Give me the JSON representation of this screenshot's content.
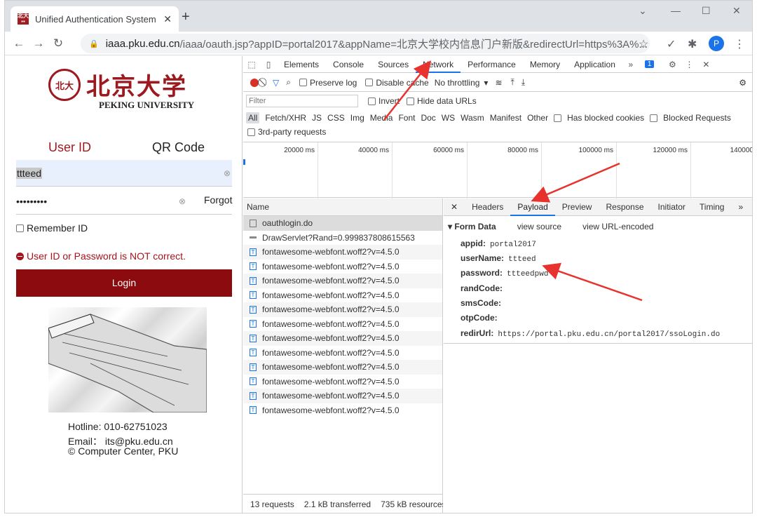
{
  "browser": {
    "tab_title": "Unified Authentication System",
    "url_host": "iaaa.pku.edu.cn",
    "url_path": "/iaaa/oauth.jsp?appID=portal2017&appName=北京大学校内信息门户新版&redirectUrl=https%3A%...",
    "profile_initial": "P"
  },
  "login": {
    "logo_cn": "北京大学",
    "logo_en": "PEKING UNIVERSITY",
    "tab_user": "User ID",
    "tab_qr": "QR Code",
    "username_value": "ttteed",
    "password_mask": "•••••••••",
    "forgot": "Forgot",
    "remember": "Remember ID",
    "error": "User ID or Password is NOT correct.",
    "login_button": "Login",
    "hotline": "Hotline: 010-62751023",
    "email": "Email： its@pku.edu.cn",
    "copyright": "© Computer Center, PKU"
  },
  "devtools": {
    "tabs": [
      "Elements",
      "Console",
      "Sources",
      "Network",
      "Performance",
      "Memory",
      "Application"
    ],
    "active_tab": "Network",
    "issues_count": "1",
    "preserve_log": "Preserve log",
    "disable_cache": "Disable cache",
    "throttling": "No throttling",
    "filter_placeholder": "Filter",
    "invert": "Invert",
    "hide_data_urls": "Hide data URLs",
    "types": [
      "All",
      "Fetch/XHR",
      "JS",
      "CSS",
      "Img",
      "Media",
      "Font",
      "Doc",
      "WS",
      "Wasm",
      "Manifest",
      "Other"
    ],
    "has_blocked_cookies": "Has blocked cookies",
    "blocked_requests": "Blocked Requests",
    "third_party": "3rd-party requests",
    "timeline_ticks": [
      "20000 ms",
      "40000 ms",
      "60000 ms",
      "80000 ms",
      "100000 ms",
      "120000 ms",
      "140000"
    ],
    "name_header": "Name",
    "requests": [
      "oauthlogin.do",
      "DrawServlet?Rand=0.999837808615563",
      "fontawesome-webfont.woff2?v=4.5.0",
      "fontawesome-webfont.woff2?v=4.5.0",
      "fontawesome-webfont.woff2?v=4.5.0",
      "fontawesome-webfont.woff2?v=4.5.0",
      "fontawesome-webfont.woff2?v=4.5.0",
      "fontawesome-webfont.woff2?v=4.5.0",
      "fontawesome-webfont.woff2?v=4.5.0",
      "fontawesome-webfont.woff2?v=4.5.0",
      "fontawesome-webfont.woff2?v=4.5.0",
      "fontawesome-webfont.woff2?v=4.5.0",
      "fontawesome-webfont.woff2?v=4.5.0",
      "fontawesome-webfont.woff2?v=4.5.0"
    ],
    "status": {
      "requests": "13 requests",
      "transferred": "2.1 kB transferred",
      "resources": "735 kB resources"
    },
    "detail_tabs": [
      "Headers",
      "Payload",
      "Preview",
      "Response",
      "Initiator",
      "Timing"
    ],
    "active_detail_tab": "Payload",
    "form_data_label": "Form Data",
    "view_source": "view source",
    "view_url_encoded": "view URL-encoded",
    "form_data": [
      {
        "key": "appid:",
        "value": "portal2017"
      },
      {
        "key": "userName:",
        "value": "ttteed"
      },
      {
        "key": "password:",
        "value": "ttteedpwd"
      },
      {
        "key": "randCode:",
        "value": ""
      },
      {
        "key": "smsCode:",
        "value": ""
      },
      {
        "key": "otpCode:",
        "value": ""
      },
      {
        "key": "redirUrl:",
        "value": "https://portal.pku.edu.cn/portal2017/ssoLogin.do"
      }
    ]
  },
  "colors": {
    "brand_red": "#9c1a1f",
    "login_btn": "#8b0b0f",
    "accent": "#1a73e8",
    "arrow": "#e8322e"
  }
}
